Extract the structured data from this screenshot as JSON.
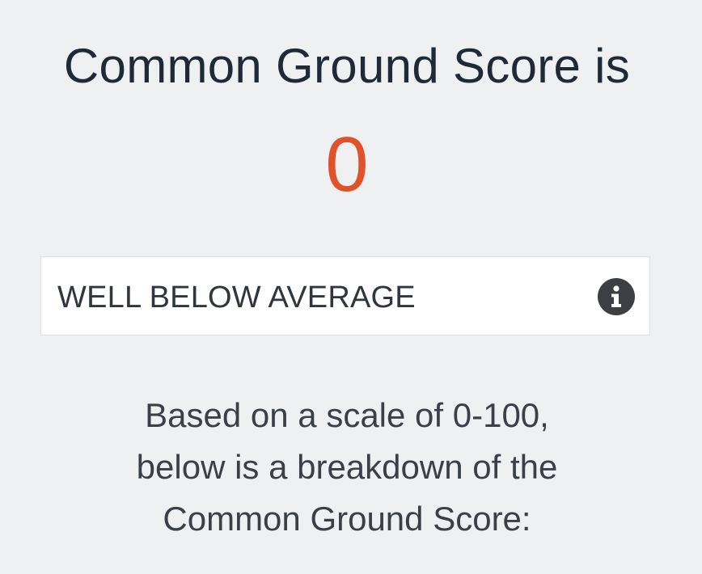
{
  "score_card": {
    "title": "Common Ground Score is",
    "score": "0",
    "score_color": "#e0532a",
    "rating": {
      "label": "WELL BELOW AVERAGE",
      "info_icon": "info-icon"
    },
    "description_lines": [
      "Based on a scale of 0-100,",
      "below is a breakdown of the",
      "Common Ground Score:"
    ]
  }
}
